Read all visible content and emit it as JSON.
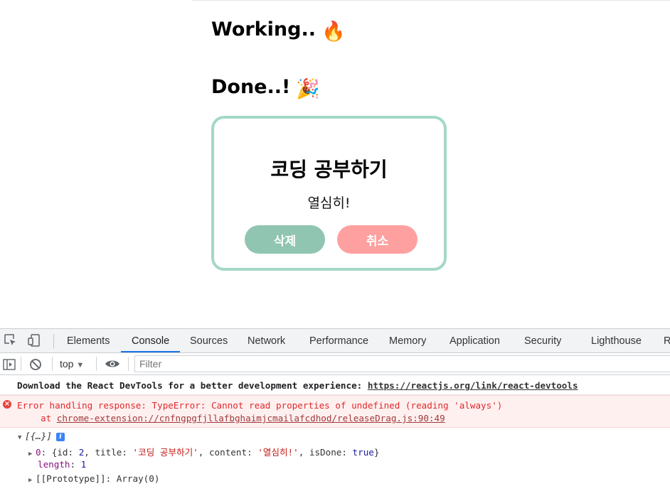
{
  "page": {
    "working_title": "Working..",
    "working_emoji": "🔥",
    "done_title": "Done..!",
    "done_emoji": "🎉",
    "card": {
      "title": "코딩 공부하기",
      "content": "열심히!",
      "delete_label": "삭제",
      "cancel_label": "취소"
    },
    "colors": {
      "card_border": "#a3d8c6",
      "delete": "#8fc5b1",
      "cancel": "#fea0a0"
    }
  },
  "devtools": {
    "tabs": [
      "Elements",
      "Console",
      "Sources",
      "Network",
      "Performance",
      "Memory",
      "Application",
      "Security",
      "Lighthouse",
      "R"
    ],
    "active_tab": "Console",
    "context": "top",
    "filter_placeholder": "Filter",
    "messages": {
      "react_devtools": "Download the React DevTools for a better development experience: ",
      "react_devtools_link": "https://reactjs.org/link/react-devtools",
      "error_line": "Error handling response: TypeError: Cannot read properties of undefined (reading 'always')",
      "error_at": "at ",
      "error_link": "chrome-extension://cnfngpgfjllafbghaimjcmailafcdhod/releaseDrag.js:90:49"
    },
    "object_log": {
      "summary": "[{…}]",
      "item_index": "0",
      "item_id": "2",
      "item_title": "'코딩 공부하기'",
      "item_content": "'열심히!'",
      "item_isDone": "true",
      "length_key": "length",
      "length_value": "1",
      "prototype_label": "[[Prototype]]",
      "prototype_value": "Array(0)"
    }
  }
}
